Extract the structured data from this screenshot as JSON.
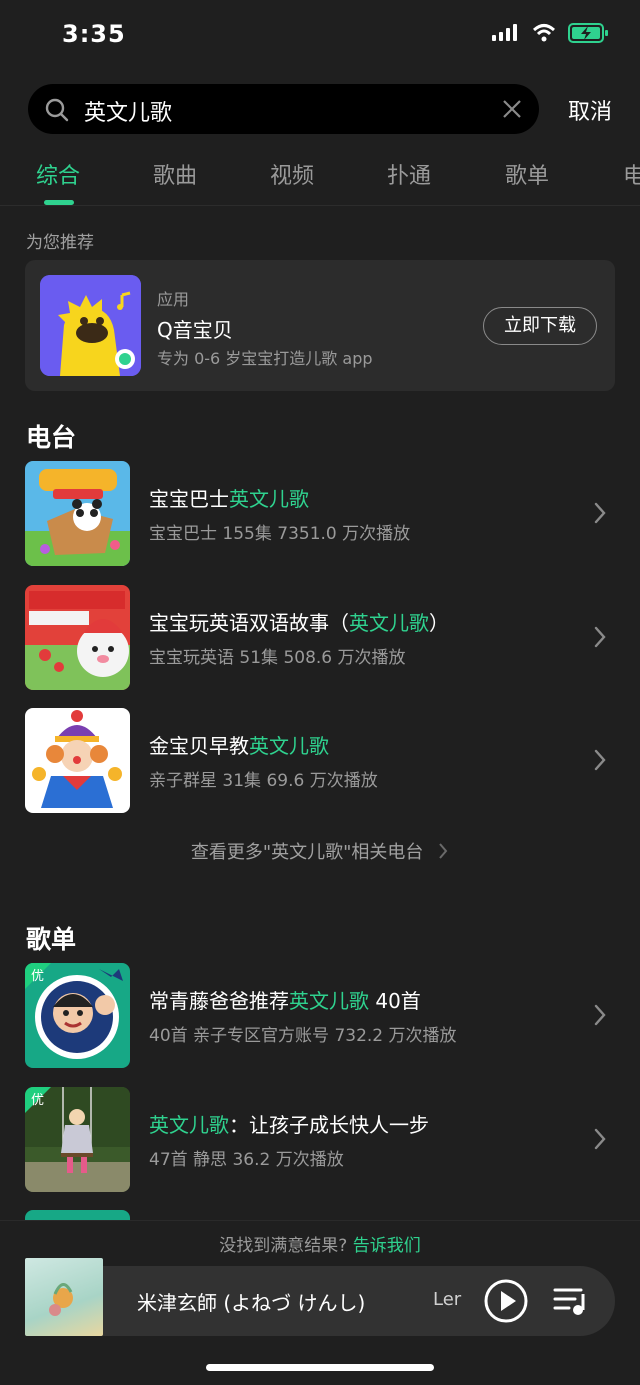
{
  "status": {
    "time": "3:35"
  },
  "search": {
    "query": "英文儿歌",
    "cancel_label": "取消"
  },
  "tabs": [
    "综合",
    "歌曲",
    "视频",
    "扑通",
    "歌单",
    "电"
  ],
  "recommend": {
    "heading": "为您推荐",
    "app": {
      "type": "应用",
      "name": "Q音宝贝",
      "desc": "专为 0-6 岁宝宝打造儿歌 app",
      "button": "立即下载"
    }
  },
  "radio": {
    "heading": "电台",
    "items": [
      {
        "title": "宝宝巴士",
        "highlight": "英文儿歌",
        "suffix": "",
        "sub": "宝宝巴士  155集  7351.0 万次播放"
      },
      {
        "title": "宝宝玩英语双语故事（",
        "highlight": "英文儿歌",
        "suffix": "）",
        "sub": "宝宝玩英语  51集  508.6 万次播放"
      },
      {
        "title": "金宝贝早教",
        "highlight": "英文儿歌",
        "suffix": "",
        "sub": "亲子群星  31集  69.6 万次播放"
      }
    ],
    "more": "查看更多\"英文儿歌\"相关电台"
  },
  "playlists": {
    "heading": "歌单",
    "items": [
      {
        "title": "常青藤爸爸推荐",
        "highlight": "英文儿歌",
        "suffix": "40首",
        "sub": "40首  亲子专区官方账号  732.2 万次播放",
        "badge": "优"
      },
      {
        "title": "",
        "highlight": "英文儿歌",
        "suffix": "：让孩子成长快人一步",
        "sub": "47首  静思  36.2 万次播放",
        "badge": "优"
      }
    ]
  },
  "feedback": {
    "text": "没找到满意结果?",
    "link": "告诉我们"
  },
  "player": {
    "song": "米津玄師 (よねづ けんし)",
    "lyric": "Ler"
  },
  "colors": {
    "accent": "#2fd28f",
    "background": "#1f1f1f",
    "card": "#2c2c2c"
  }
}
